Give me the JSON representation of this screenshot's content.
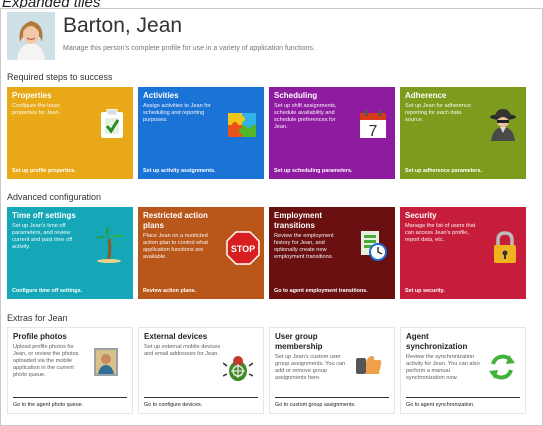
{
  "caption": "Expanded tiles",
  "profile": {
    "name": "Barton, Jean",
    "subtitle": "Manage this person's complete profile for use in a variety of application functions."
  },
  "sections": {
    "required": "Required steps to success",
    "advanced": "Advanced configuration",
    "extras": "Extras for Jean"
  },
  "tiles_required": [
    {
      "title": "Properties",
      "desc": "Configure the basic properties for Jean.",
      "footer": "Set up profile properties.",
      "color": "#e8a817",
      "icon": "clipboard-check-icon"
    },
    {
      "title": "Activities",
      "desc": "Assign activities to Jean for scheduling and reporting purposes.",
      "footer": "Set up activity assignments.",
      "color": "#1c73d6",
      "icon": "puzzle-icon"
    },
    {
      "title": "Scheduling",
      "desc": "Set up shift assignments, schedule availability and schedule preferences for Jean.",
      "footer": "Set up scheduling parameters.",
      "color": "#8f1ba0",
      "icon": "calendar-icon"
    },
    {
      "title": "Adherence",
      "desc": "Set up Jean for adherence reporting for each data source.",
      "footer": "Set up adherence parameters.",
      "color": "#7d9b1c",
      "icon": "spy-icon"
    }
  ],
  "tiles_advanced": [
    {
      "title": "Time off settings",
      "desc": "Set up Jean's time off parameters, and review current and past time off activity.",
      "footer": "Configure time off settings.",
      "color": "#15a7b8",
      "icon": "palm-tree-icon"
    },
    {
      "title": "Restricted action plans",
      "desc": "Place Jean on a restricted action plan to control what application functions are available.",
      "footer": "Review action plans.",
      "color": "#b9561a",
      "icon": "stop-sign-icon"
    },
    {
      "title": "Employment transitions",
      "desc": "Review the employment history for Jean, and optionally create new employment transitions.",
      "footer": "Go to agent employment transitions.",
      "color": "#6a1010",
      "icon": "transition-icon"
    },
    {
      "title": "Security",
      "desc": "Manage the list of users that can access Jean's profile, report data, etc.",
      "footer": "Set up security.",
      "color": "#c51d3a",
      "icon": "padlock-icon"
    }
  ],
  "tiles_extras": [
    {
      "title": "Profile photos",
      "desc": "Upload profile photos for Jean, or review the photos uploaded via the mobile application in the current photo queue.",
      "footer": "Go to the agent photo queue.",
      "icon": "photo-icon"
    },
    {
      "title": "External devices",
      "desc": "Set up external mobile devices and email addresses for Jean.",
      "footer": "Go to configure devices.",
      "icon": "bug-icon"
    },
    {
      "title": "User group membership",
      "desc": "Set up Jean's custom user group assignments. You can add or remove group assignments here.",
      "footer": "Go to custom group assignments.",
      "icon": "group-icon"
    },
    {
      "title": "Agent synchronization",
      "desc": "Review the synchronization activity for Jean. You can also perform a manual synchronization now.",
      "footer": "Go to agent synchronization.",
      "icon": "sync-icon"
    }
  ],
  "icon_text": {
    "calendar_day": "7",
    "stop": "STOP"
  }
}
